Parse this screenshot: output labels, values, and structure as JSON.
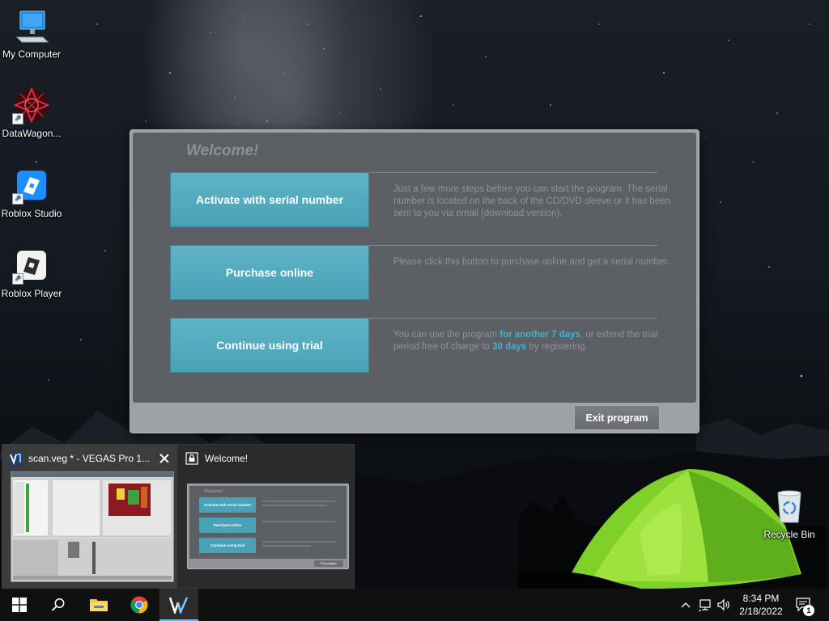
{
  "desktop": {
    "icons": [
      {
        "label": "My Computer"
      },
      {
        "label": "DataWagon..."
      },
      {
        "label": "Roblox Studio"
      },
      {
        "label": "Roblox Player"
      },
      {
        "label": "Recycle Bin"
      }
    ]
  },
  "dialog": {
    "title": "Welcome!",
    "options": [
      {
        "button": "Activate with serial number",
        "description": "Just a few more steps before you can start the program. The serial number is located on the back of the CD/DVD sleeve or it has been sent to you via email (download version)."
      },
      {
        "button": "Purchase online",
        "description": "Please click this button to purchase online and get a serial number."
      },
      {
        "button": "Continue using trial",
        "description_parts": [
          "You can use the program ",
          "for another 7 days",
          ", or extend the trial period free of charge to ",
          "30 days",
          " by registering."
        ]
      }
    ],
    "exit_button": "Exit program"
  },
  "thumbnails": [
    {
      "title": "scan.veg * - VEGAS Pro 1...",
      "active": true
    },
    {
      "title": "Welcome!",
      "active": false
    }
  ],
  "thumbnail_preview": {
    "title": "Welcome!",
    "buttons": [
      "Activate with serial number",
      "Purchase online",
      "Continue using trial"
    ],
    "exit": "Exit program"
  },
  "taskbar": {
    "pinned": [
      "windows-start",
      "search",
      "file-explorer",
      "chrome",
      "vegas-pro"
    ],
    "clock_time": "8:34 PM",
    "clock_date": "2/18/2022",
    "notification_count": "1"
  },
  "colors": {
    "accent_button": "#4aa2b6",
    "highlight_text": "#3fb4d6",
    "dialog_bg": "#5c5f64"
  }
}
